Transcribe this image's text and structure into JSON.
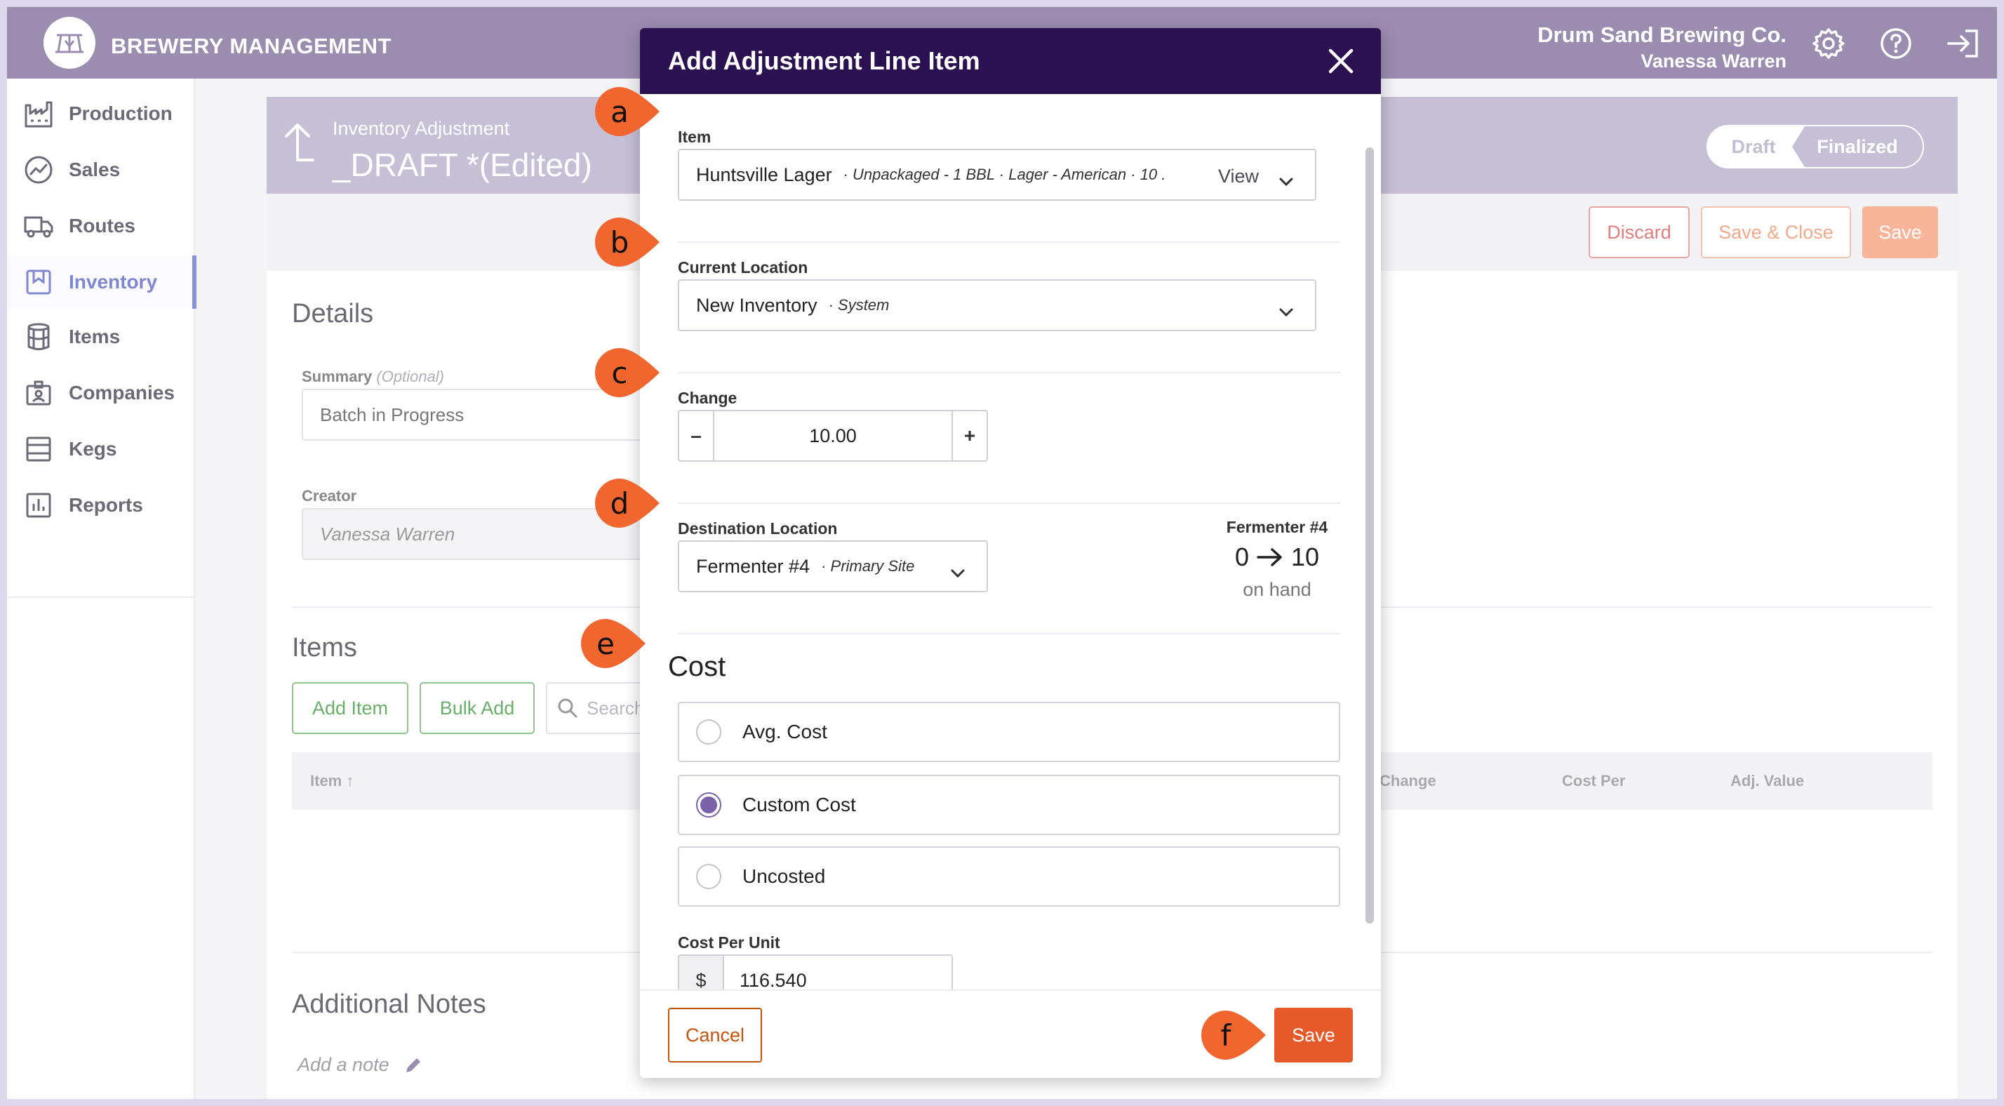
{
  "app": {
    "title": "BREWERY MANAGEMENT",
    "company": "Drum Sand Brewing Co.",
    "user": "Vanessa Warren",
    "icons": [
      "logo-icon",
      "settings-icon",
      "help-icon",
      "logout-icon"
    ]
  },
  "sidebar": {
    "items": [
      {
        "label": "Production",
        "icon": "factory-icon"
      },
      {
        "label": "Sales",
        "icon": "chart-icon"
      },
      {
        "label": "Routes",
        "icon": "truck-icon"
      },
      {
        "label": "Inventory",
        "icon": "inventory-icon",
        "active": true
      },
      {
        "label": "Items",
        "icon": "barrel-icon"
      },
      {
        "label": "Companies",
        "icon": "company-icon"
      },
      {
        "label": "Kegs",
        "icon": "kegs-icon"
      },
      {
        "label": "Reports",
        "icon": "reports-icon"
      }
    ]
  },
  "page": {
    "subtitle": "Inventory Adjustment",
    "title": "_DRAFT *(Edited)",
    "status": {
      "draft": "Draft",
      "finalized": "Finalized"
    },
    "actions": {
      "discard": "Discard",
      "save_close": "Save & Close",
      "save": "Save"
    },
    "details": {
      "title": "Details",
      "summary_label": "Summary",
      "summary_optional": "(Optional)",
      "summary_value": "Batch in Progress",
      "creator_label": "Creator",
      "creator_value": "Vanessa Warren"
    },
    "items": {
      "title": "Items",
      "add_item": "Add Item",
      "bulk_add": "Bulk Add",
      "search_placeholder": "Search",
      "columns": {
        "item": "Item",
        "change": "Change",
        "cost_per": "Cost Per",
        "adj_value": "Adj. Value"
      }
    },
    "notes": {
      "title": "Additional Notes",
      "placeholder": "Add a note"
    }
  },
  "modal": {
    "title": "Add Adjustment Line Item",
    "item": {
      "label": "Item",
      "value": "Huntsville Lager",
      "detail": "· Unpackaged - 1 BBL · Lager - American · 10 .",
      "view": "View"
    },
    "current_location": {
      "label": "Current Location",
      "value": "New Inventory",
      "detail": "· System"
    },
    "change": {
      "label": "Change",
      "value": "10.00",
      "minus": "–",
      "plus": "+"
    },
    "destination": {
      "label": "Destination Location",
      "value": "Fermenter #4",
      "detail": "· Primary Site",
      "onhand_location": "Fermenter #4",
      "onhand_from": "0",
      "onhand_to": "10",
      "onhand_note": "on hand"
    },
    "cost": {
      "title": "Cost",
      "options": [
        {
          "label": "Avg. Cost",
          "checked": false
        },
        {
          "label": "Custom Cost",
          "checked": true
        },
        {
          "label": "Uncosted",
          "checked": false
        }
      ],
      "per_unit_label": "Cost Per Unit",
      "currency": "$",
      "per_unit_value": "116.540"
    },
    "cancel": "Cancel",
    "save": "Save"
  },
  "markers": [
    "a",
    "b",
    "c",
    "d",
    "e",
    "f"
  ],
  "colors": {
    "topbar": "#9b8db0",
    "modal_header": "#2b1151",
    "accent_orange": "#e55a28",
    "active_nav": "#7f88cf",
    "radio_checked": "#7a62a8",
    "marker": "#f0662e"
  }
}
